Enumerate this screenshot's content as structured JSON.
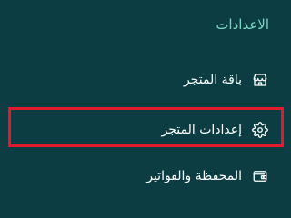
{
  "sidebar": {
    "section_title": "الاعدادات",
    "items": [
      {
        "label": "باقة المتجر",
        "icon": "store-icon"
      },
      {
        "label": "إعدادات المتجر",
        "icon": "gear-icon",
        "highlighted": true
      },
      {
        "label": "المحفظة والفواتير",
        "icon": "wallet-icon"
      }
    ]
  },
  "colors": {
    "background": "#0b3d42",
    "section_title": "#79d6c1",
    "text": "#ffffff",
    "highlight_border": "#e21b2c"
  }
}
